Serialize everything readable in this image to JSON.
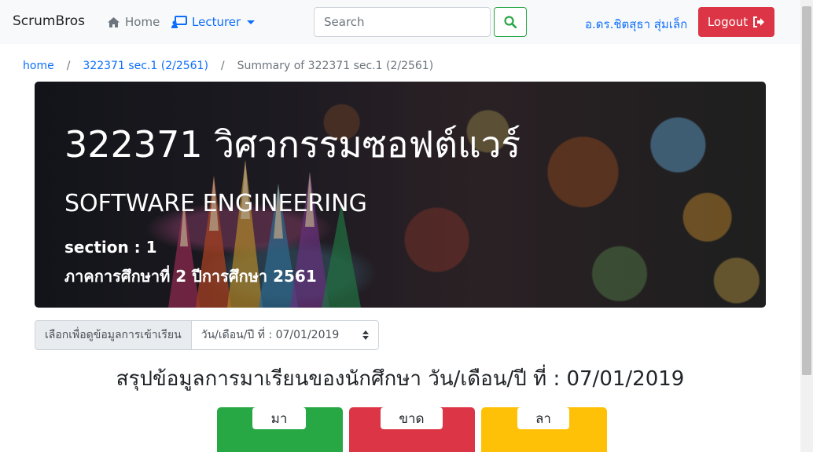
{
  "navbar": {
    "brand": "ScrumBros",
    "home_label": "Home",
    "lecturer_label": "Lecturer",
    "search_placeholder": "Search",
    "user_name": "อ.ดร.ชิตสุธา สุ่มเล็ก",
    "logout_label": "Logout"
  },
  "breadcrumb": {
    "items": [
      "home",
      "322371 sec.1 (2/2561)",
      "Summary of 322371 sec.1 (2/2561)"
    ],
    "separator": "/"
  },
  "hero": {
    "title": "322371 วิศวกรรมซอฟต์แวร์",
    "subtitle": "SOFTWARE ENGINEERING",
    "section": "section : 1",
    "term": "ภาคการศึกษาที่ 2 ปีการศึกษา 2561"
  },
  "selector": {
    "label": "เลือกเพื่อดูข้อมูลการเข้าเรียน",
    "value": "วัน/เดือน/ปี ที่ : 07/01/2019"
  },
  "summary": {
    "title": "สรุปข้อมูลการมาเรียนของนักศึกษา วัน/เดือน/ปี ที่ : 07/01/2019"
  },
  "cards": [
    {
      "label": "มา",
      "color": "#28a745"
    },
    {
      "label": "ขาด",
      "color": "#dc3545"
    },
    {
      "label": "ลา",
      "color": "#ffc107"
    }
  ],
  "colors": {
    "primary": "#0d6efd",
    "success": "#28a745",
    "danger": "#dc3545",
    "warning": "#ffc107"
  },
  "icons": {
    "home": "home-icon",
    "lecturer": "chalkboard-teacher-icon",
    "search": "search-icon",
    "logout": "sign-out-icon"
  }
}
